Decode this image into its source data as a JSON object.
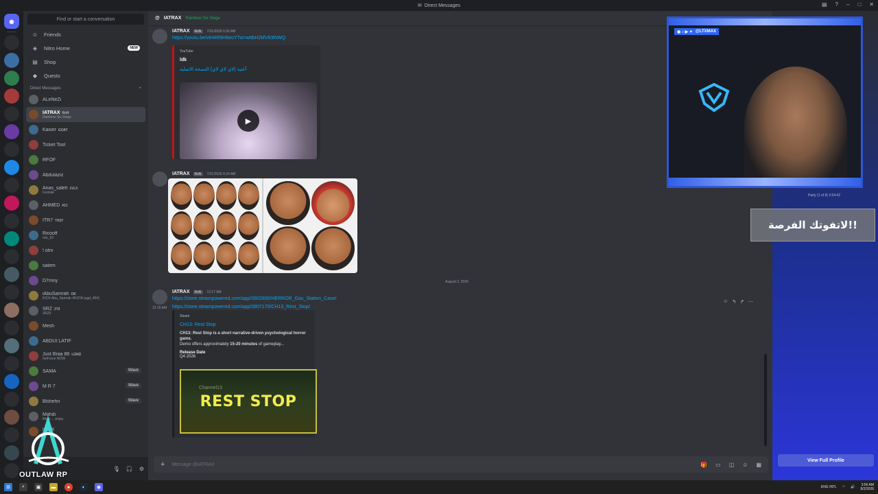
{
  "window": {
    "title": "Direct Messages"
  },
  "sidebar": {
    "search_placeholder": "Find or start a conversation",
    "nav": [
      {
        "label": "Friends",
        "icon": "friends-icon"
      },
      {
        "label": "Nitro Home",
        "icon": "nitro-icon",
        "badge": "NEW"
      },
      {
        "label": "Shop",
        "icon": "shop-icon"
      },
      {
        "label": "Quests",
        "icon": "quests-icon"
      }
    ],
    "dm_header": "Direct Messages",
    "dm_add": "+",
    "dms": [
      {
        "name": "ALeNeZi",
        "sub": ""
      },
      {
        "name": "IATRAX",
        "tag": "RoN",
        "sub": "Rainbow Six Siege",
        "active": true
      },
      {
        "name": "Kaiser",
        "tag": "GOAT",
        "sub": ""
      },
      {
        "name": "Ticket Tool",
        "sub": ""
      },
      {
        "name": "RFOF",
        "sub": ""
      },
      {
        "name": "Abdulaziz",
        "sub": ""
      },
      {
        "name": "Anas_saleh",
        "tag": "LVL3",
        "sub": "Fortnite"
      },
      {
        "name": "AHMED",
        "tag": "#21",
        "sub": ""
      },
      {
        "name": "ITR7",
        "tag": "TR37",
        "sub": ""
      },
      {
        "name": "Ricooff",
        "sub": "rick_92"
      },
      {
        "name": "! otrx",
        "sub": ""
      },
      {
        "name": "salem",
        "sub": ""
      },
      {
        "name": "D7mny",
        "sub": ""
      },
      {
        "name": "iAbuSamrah",
        "tag": "OK",
        "sub": "KICK Abu_Samrah #KSTA (ugd_454)"
      },
      {
        "name": "SRZ",
        "tag": "279",
        "sub": "SK29"
      },
      {
        "name": "Mesh",
        "sub": ""
      },
      {
        "name": "ABDUI LATIF",
        "sub": ""
      },
      {
        "name": "Just Braa 88",
        "tag": "LGND",
        "sub": "GeForce NOW"
      },
      {
        "name": "SAMA",
        "sub": "",
        "wave": "Wave"
      },
      {
        "name": "M R 7",
        "sub": "",
        "wave": "Wave"
      },
      {
        "name": "Blshehri",
        "sub": "",
        "wave": "Wave"
      },
      {
        "name": "Mahdi",
        "sub": "life is ... enjoy"
      },
      {
        "name": "lightX",
        "sub": "kick ..."
      }
    ]
  },
  "logo": {
    "text": "OUTLAW RP"
  },
  "chat": {
    "header_name": "IATRAX",
    "header_status": "Rainbow Six Siege",
    "messages": [
      {
        "author": "IATRAX",
        "tag": "RoN",
        "time": "7/31/2026 5:56 AM",
        "link": "https://youtu.be/vtH4R9H6eoY?si=wttbH2kfV83thWQ",
        "embed": {
          "provider": "YouTube",
          "title": "ldk",
          "desc": "أغنية (لاي لاي لاي) النسخة الاصلية"
        }
      },
      {
        "author": "IATRAX",
        "tag": "RoN",
        "time": "7/31/2026 6:24 AM"
      },
      {
        "author": "IATRAX",
        "tag": "RoN",
        "time": "12:17 AM",
        "link": "https://store.steampowered.com/app/3902800/HERROR_Gas_Station_Case/",
        "link2": "https://store.steampowered.com/app/3907170/CH13_Rest_Stop/",
        "time_left": "12:16 AM",
        "embed": {
          "provider": "Steam",
          "title": "CH13: Rest Stop",
          "desc": "CH13: Rest Stop is a short narrative-driven psychological horror game.",
          "desc2_pre": "Demo offers approximately ",
          "desc2_bold": "15-20 minutes",
          "desc2_post": " of gameplay...",
          "field_name": "Release Date",
          "field_value": "Q4 2026",
          "image_big": "REST STOP",
          "image_small": "Channel13"
        }
      }
    ],
    "date_divider": "August 2, 2026",
    "composer_placeholder": "Message @IATRAX"
  },
  "profile": {
    "view_full": "View Full Profile",
    "activity": "Party (1 of 8)   3:54:42"
  },
  "overlay": {
    "socials": "@LTXMAX",
    "promo": "لاتفوتك الفرصة!!"
  },
  "taskbar": {
    "lang": "ENG INTL",
    "time": "3:56 AM",
    "date": "8/2/2026"
  },
  "colors": {
    "accent": "#5865f2",
    "link": "#00a8fc",
    "online": "#23a55a",
    "youtube": "#c0161a",
    "stream_frame": "#2f56d4"
  }
}
